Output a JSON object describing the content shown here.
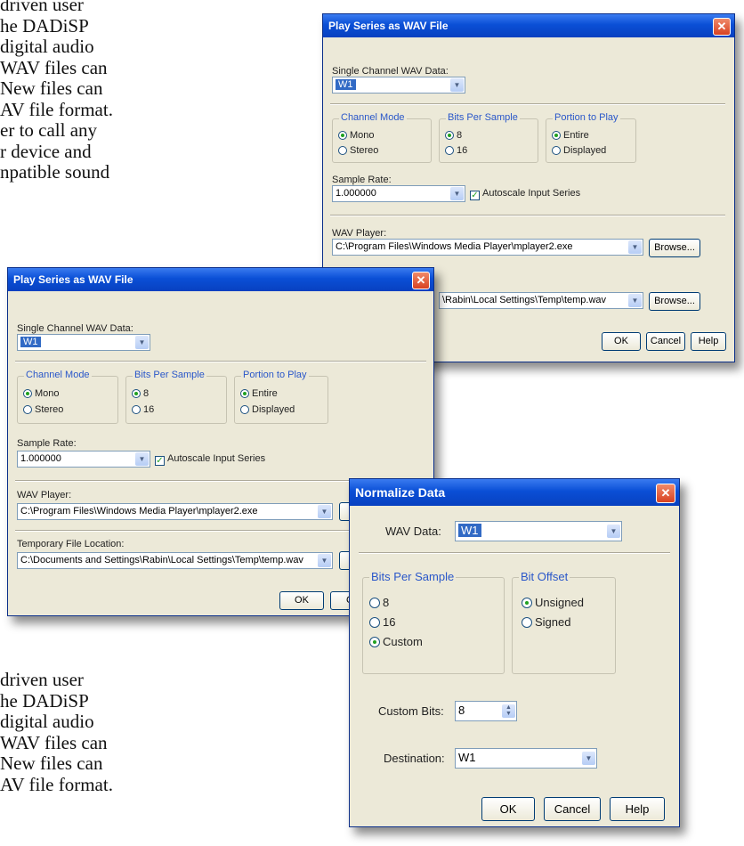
{
  "background_text": {
    "top": [
      "driven user",
      "he DADiSP",
      "digital audio",
      "WAV files can",
      "New files can",
      "AV file format.",
      "er to call any",
      "r device and",
      "npatible sound"
    ],
    "bottom": [
      "driven user",
      "he DADiSP",
      "digital audio",
      "WAV files can",
      "New files can",
      "AV file format."
    ]
  },
  "play_dialog_back": {
    "title": "Play Series as WAV File",
    "channel_label": "Single Channel WAV Data:",
    "channel_value": "W1",
    "channel_mode": {
      "title": "Channel Mode",
      "options": [
        "Mono",
        "Stereo"
      ],
      "selected": "Mono"
    },
    "bits": {
      "title": "Bits Per Sample",
      "options": [
        "8",
        "16"
      ],
      "selected": "8"
    },
    "portion": {
      "title": "Portion to Play",
      "options": [
        "Entire",
        "Displayed"
      ],
      "selected": "Entire"
    },
    "sample_rate_label": "Sample Rate:",
    "sample_rate_value": "1.000000",
    "autoscale_label": "Autoscale Input Series",
    "wav_player_label": "WAV Player:",
    "wav_player_value": "C:\\Program Files\\Windows Media Player\\mplayer2.exe",
    "temp_value": "\\Rabin\\Local Settings\\Temp\\temp.wav",
    "browse": "Browse...",
    "ok": "OK",
    "cancel": "Cancel",
    "help": "Help"
  },
  "play_dialog_front": {
    "title": "Play Series as WAV File",
    "channel_label": "Single Channel WAV Data:",
    "channel_value": "W1",
    "channel_mode": {
      "title": "Channel Mode",
      "options": [
        "Mono",
        "Stereo"
      ],
      "selected": "Mono"
    },
    "bits": {
      "title": "Bits Per Sample",
      "options": [
        "8",
        "16"
      ],
      "selected": "8"
    },
    "portion": {
      "title": "Portion to Play",
      "options": [
        "Entire",
        "Displayed"
      ],
      "selected": "Entire"
    },
    "sample_rate_label": "Sample Rate:",
    "sample_rate_value": "1.000000",
    "autoscale_label": "Autoscale Input Series",
    "wav_player_label": "WAV Player:",
    "wav_player_value": "C:\\Program Files\\Windows Media Player\\mplayer2.exe",
    "temp_label": "Temporary File Location:",
    "temp_value": "C:\\Documents and Settings\\Rabin\\Local Settings\\Temp\\temp.wav",
    "browse_partial": "B",
    "ok": "OK",
    "cancel_partial": "Ca"
  },
  "normalize_dialog": {
    "title": "Normalize Data",
    "wav_data_label": "WAV Data:",
    "wav_data_value": "W1",
    "bits": {
      "title": "Bits Per Sample",
      "options": [
        "8",
        "16",
        "Custom"
      ],
      "selected": "Custom"
    },
    "offset": {
      "title": "Bit Offset",
      "options": [
        "Unsigned",
        "Signed"
      ],
      "selected": "Unsigned"
    },
    "custom_bits_label": "Custom Bits:",
    "custom_bits_value": "8",
    "destination_label": "Destination:",
    "destination_value": "W1",
    "ok": "OK",
    "cancel": "Cancel",
    "help": "Help"
  },
  "icons": {
    "close": "close-icon",
    "dropdown": "chevron-down-icon",
    "spinner": "spinner-arrows-icon",
    "check": "checkmark-icon"
  }
}
